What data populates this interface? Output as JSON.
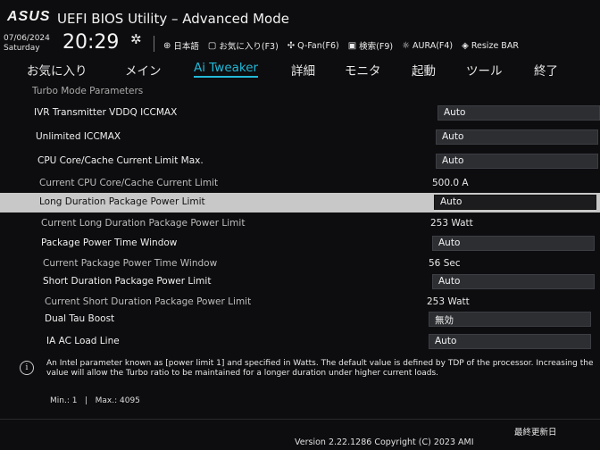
{
  "header": {
    "logo": "ASUS",
    "title": "UEFI BIOS Utility – Advanced Mode",
    "date": "07/06/2024",
    "day": "Saturday",
    "time": "20:29",
    "shortcuts": [
      {
        "icon": "globe-icon",
        "label": "日本語"
      },
      {
        "icon": "favorites-icon",
        "label": "お気に入り(F3)"
      },
      {
        "icon": "fan-icon",
        "label": "Q-Fan(F6)"
      },
      {
        "icon": "search-icon",
        "label": "検索(F9)"
      },
      {
        "icon": "aura-icon",
        "label": "AURA(F4)"
      },
      {
        "icon": "resize-bar-icon",
        "label": "Resize BAR"
      }
    ]
  },
  "tabs": [
    {
      "label": "お気に入り"
    },
    {
      "label": "メイン"
    },
    {
      "label": "Ai Tweaker",
      "active": true
    },
    {
      "label": "詳細"
    },
    {
      "label": "モニタ"
    },
    {
      "label": "起動"
    },
    {
      "label": "ツール"
    },
    {
      "label": "終了"
    }
  ],
  "section": "Turbo Mode Parameters",
  "settings": [
    {
      "label": "IVR Transmitter VDDQ ICCMAX",
      "value": "Auto",
      "type": "dropdown"
    },
    {
      "label": "Unlimited ICCMAX",
      "value": "Auto",
      "type": "dropdown"
    },
    {
      "label": "CPU Core/Cache Current Limit Max.",
      "value": "Auto",
      "type": "dropdown"
    },
    {
      "label": "Current CPU Core/Cache Current Limit",
      "value": "500.0 A",
      "type": "readonly"
    },
    {
      "label": "Long Duration Package Power Limit",
      "value": "Auto",
      "type": "dropdown",
      "highlighted": true
    },
    {
      "label": "Current Long Duration Package Power Limit",
      "value": "253 Watt",
      "type": "readonly"
    },
    {
      "label": "Package Power Time Window",
      "value": "Auto",
      "type": "dropdown"
    },
    {
      "label": "Current Package Power Time Window",
      "value": "56 Sec",
      "type": "readonly"
    },
    {
      "label": "Short Duration Package Power Limit",
      "value": "Auto",
      "type": "dropdown"
    },
    {
      "label": "Current Short Duration Package Power Limit",
      "value": "253 Watt",
      "type": "readonly"
    },
    {
      "label": "Dual Tau Boost",
      "value": "無効",
      "type": "dropdown"
    },
    {
      "label": "IA AC Load Line",
      "value": "Auto",
      "type": "dropdown"
    }
  ],
  "help": {
    "text": "An Intel parameter known as [power limit 1] and specified in Watts. The default value is defined by TDP of the processor. Increasing the value will allow the Turbo ratio to be maintained for a longer duration under higher current loads.",
    "minmax": "Min.: 1   |   Max.: 4095"
  },
  "footer": {
    "last_modified": "最終更新日",
    "version": "Version 2.22.1286 Copyright (C) 2023 AMI"
  },
  "colors": {
    "accent": "#22b8d8",
    "background": "#0d0d0f",
    "highlight_row": "#c8c8c8",
    "dropdown_bg": "#2c2e32"
  }
}
